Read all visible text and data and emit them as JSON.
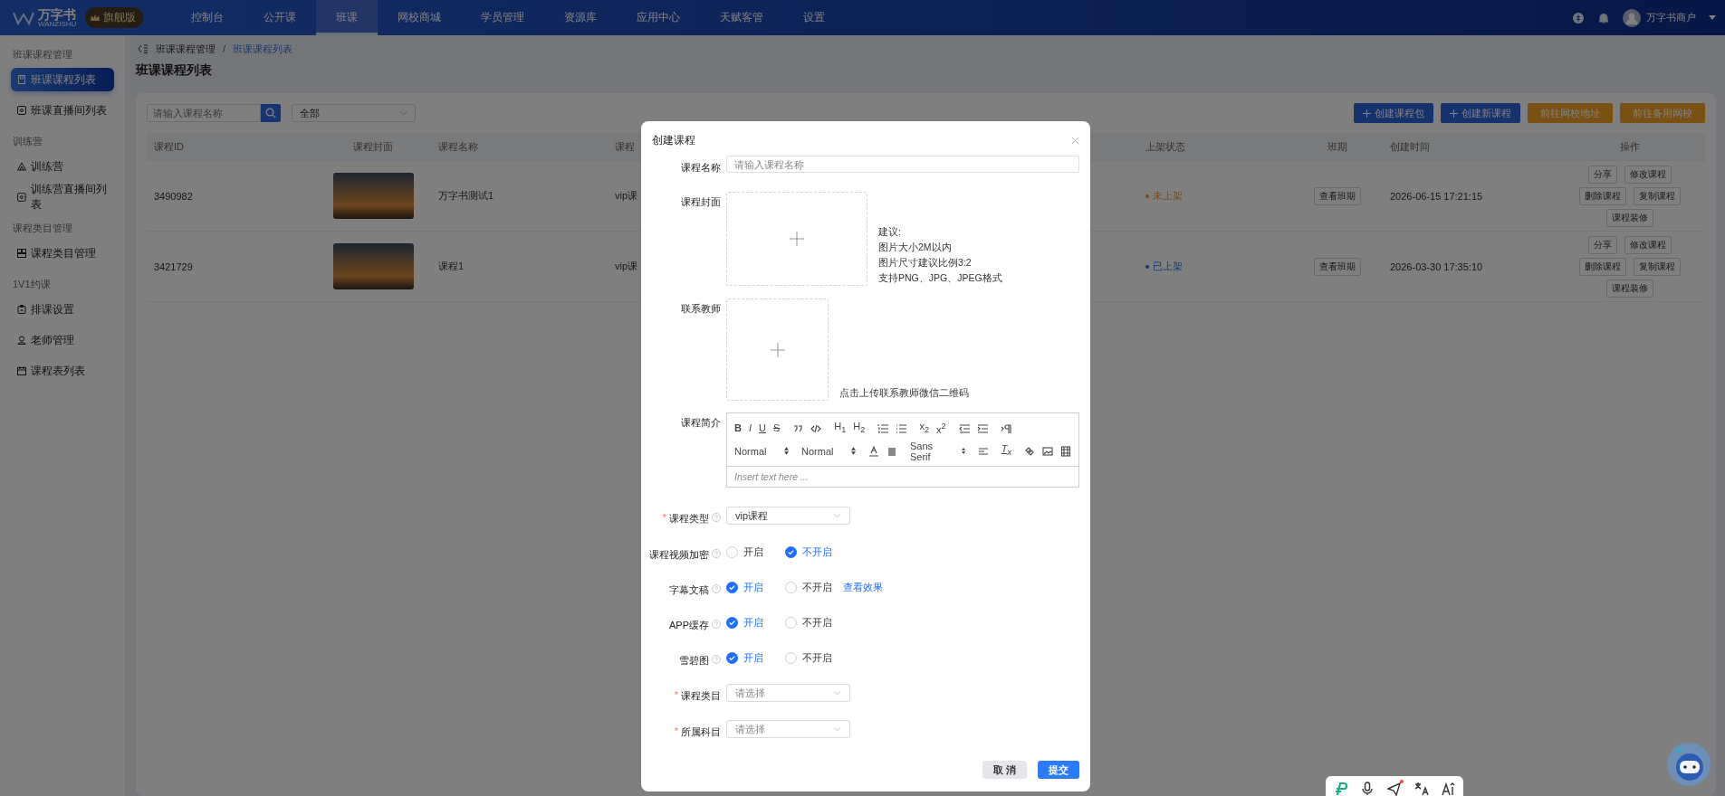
{
  "top_nav": {
    "logo_text": "万字书",
    "logo_subtext": "WANZISHU",
    "edition_badge": "旗舰版",
    "items": [
      {
        "label": "控制台",
        "selected": false
      },
      {
        "label": "公开课",
        "selected": false
      },
      {
        "label": "班课",
        "selected": true
      },
      {
        "label": "网校商城",
        "selected": false
      },
      {
        "label": "学员管理",
        "selected": false
      },
      {
        "label": "资源库",
        "selected": false
      },
      {
        "label": "应用中心",
        "selected": false
      },
      {
        "label": "天赋客管",
        "selected": false
      },
      {
        "label": "设置",
        "selected": false
      }
    ],
    "user_name": "万字书商户"
  },
  "sidebar": {
    "groups": [
      {
        "title": "班课课程管理",
        "items": [
          {
            "label": "班课课程列表",
            "selected": true,
            "kind": "document"
          },
          {
            "label": "班课直播间列表",
            "selected": false,
            "kind": "live"
          }
        ]
      },
      {
        "title": "训练营",
        "items": [
          {
            "label": "训练营",
            "selected": false,
            "kind": "camp"
          },
          {
            "label": "训练营直播间列表",
            "selected": false,
            "kind": "live"
          }
        ]
      },
      {
        "title": "课程类目管理",
        "items": [
          {
            "label": "课程类目管理",
            "selected": false,
            "kind": "category"
          }
        ]
      },
      {
        "title": "1V1约课",
        "items": [
          {
            "label": "排课设置",
            "selected": false,
            "kind": "clipboard"
          },
          {
            "label": "老师管理",
            "selected": false,
            "kind": "person"
          },
          {
            "label": "课程表列表",
            "selected": false,
            "kind": "calendar"
          }
        ]
      }
    ]
  },
  "breadcrumb": {
    "separator": "/",
    "items": [
      {
        "label": "班课课程管理",
        "selected": false
      },
      {
        "label": "班课课程列表",
        "selected": true
      }
    ]
  },
  "page_title": "班课课程列表",
  "filters": {
    "search": {
      "placeholder": "请输入课程名称"
    },
    "status_select": {
      "value": "全部"
    }
  },
  "actions": [
    {
      "label": "创建课程包",
      "kind": "primary"
    },
    {
      "label": "创建新课程",
      "kind": "primary"
    },
    {
      "label": "前往网校地址",
      "kind": "warning"
    },
    {
      "label": "前往备用网校",
      "kind": "warning"
    }
  ],
  "table": {
    "columns": [
      "课程ID",
      "课程封面",
      "课程名称",
      "课程",
      "上架状态",
      "班期",
      "创建时间",
      "操作"
    ],
    "rows": [
      {
        "course_id": "3490982",
        "course_name": "万字书测试1",
        "course_type": "vip课",
        "status": {
          "label": "未上架",
          "kind": "unpublished"
        },
        "period_button": "查看班期",
        "created_at": "2026-06-15 17:21:15",
        "actions": [
          "分享",
          "修改课程",
          "删除课程",
          "复制课程",
          "课程装修"
        ]
      },
      {
        "course_id": "3421729",
        "course_name": "课程1",
        "course_type": "vip课",
        "status": {
          "label": "已上架",
          "kind": "published"
        },
        "period_button": "查看班期",
        "created_at": "2026-03-30 17:35:10",
        "actions": [
          "分享",
          "修改课程",
          "删除课程",
          "复制课程",
          "课程装修"
        ]
      }
    ]
  },
  "dialog": {
    "title": "创建课程",
    "required_mark": "*",
    "fields": [
      {
        "kind": "input",
        "label": "课程名称",
        "required": false,
        "help": false,
        "placeholder": "请输入课程名称"
      },
      {
        "kind": "upload",
        "label": "课程封面",
        "required": false,
        "help": false,
        "hint": [
          "建议:",
          "图片大小2M以内",
          "图片尺寸建议比例3:2",
          "支持PNG、JPG、JPEG格式"
        ]
      },
      {
        "kind": "qrcode",
        "label": "联系教师",
        "required": false,
        "help": false,
        "hint": [
          "点击上传联系教师微信二维码"
        ]
      },
      {
        "kind": "editor",
        "label": "课程简介",
        "required": false,
        "help": false,
        "placeholder": "Insert text here ...",
        "toolbar": [
          [
            [
              {
                "kind": "bold",
                "text": "B"
              },
              {
                "kind": "italic",
                "text": "I"
              },
              {
                "kind": "underline",
                "text": "U"
              },
              {
                "kind": "strike",
                "text": "S"
              }
            ],
            [
              {
                "kind": "quote"
              },
              {
                "kind": "code"
              }
            ],
            [
              {
                "kind": "heading",
                "text": "H$_{1}$"
              },
              {
                "kind": "heading",
                "text": "H$_{2}$"
              }
            ],
            [
              {
                "kind": "ordered-list"
              },
              {
                "kind": "bullet-list"
              }
            ],
            [
              {
                "kind": "script",
                "text": "x$_{2}$"
              },
              {
                "kind": "script",
                "text": "x$^{2}$"
              }
            ],
            [
              {
                "kind": "outdent"
              },
              {
                "kind": "indent"
              }
            ],
            [
              {
                "kind": "direction"
              }
            ]
          ],
          [
            [
              {
                "kind": "picker",
                "text": "Normal"
              }
            ],
            [
              {
                "kind": "picker",
                "text": "Normal"
              }
            ],
            [
              {
                "kind": "text-color"
              },
              {
                "kind": "background"
              }
            ],
            [
              {
                "kind": "picker",
                "text": "Sans Serif"
              }
            ],
            [
              {
                "kind": "align"
              }
            ],
            [
              {
                "kind": "clean",
                "text": "T$_{x}$"
              }
            ],
            [
              {
                "kind": "link"
              },
              {
                "kind": "image"
              },
              {
                "kind": "video"
              }
            ]
          ]
        ]
      },
      {
        "kind": "select",
        "label": "课程类型",
        "required": true,
        "help": true,
        "value": "vip课程"
      },
      {
        "kind": "radio",
        "label": "课程视频加密",
        "required": false,
        "help": true,
        "options": [
          {
            "label": "开启",
            "selected": false
          },
          {
            "label": "不开启",
            "selected": true
          }
        ]
      },
      {
        "kind": "radio",
        "label": "字幕文稿",
        "required": false,
        "help": true,
        "options": [
          {
            "label": "开启",
            "selected": true
          },
          {
            "label": "不开启",
            "selected": false
          }
        ],
        "link": "查看效果"
      },
      {
        "kind": "radio",
        "label": "APP缓存",
        "required": false,
        "help": true,
        "options": [
          {
            "label": "开启",
            "selected": true
          },
          {
            "label": "不开启",
            "selected": false
          }
        ]
      },
      {
        "kind": "radio",
        "label": "雪碧图",
        "required": false,
        "help": true,
        "options": [
          {
            "label": "开启",
            "selected": true
          },
          {
            "label": "不开启",
            "selected": false
          }
        ]
      },
      {
        "kind": "select",
        "label": "课程类目",
        "required": true,
        "help": false,
        "placeholder": "请选择"
      },
      {
        "kind": "select",
        "label": "所属科目",
        "required": true,
        "help": false,
        "placeholder": "请选择"
      }
    ],
    "buttons": [
      {
        "label": "取 消",
        "kind": "cancel"
      },
      {
        "label": "提交",
        "kind": "submit"
      }
    ]
  },
  "floating_toolbar": {
    "items": [
      {
        "kind": "logo",
        "badge": false
      },
      {
        "kind": "microphone",
        "badge": false
      },
      {
        "kind": "send",
        "badge": true
      },
      {
        "kind": "translate",
        "badge": false
      },
      {
        "kind": "font-size",
        "badge": false
      }
    ]
  }
}
